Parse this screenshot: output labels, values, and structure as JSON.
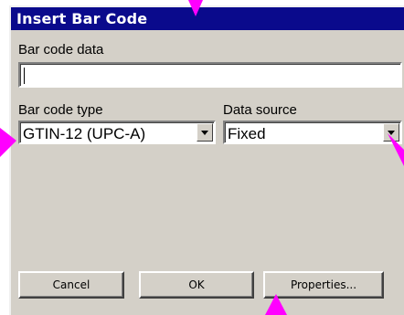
{
  "dialog": {
    "title": "Insert Bar Code"
  },
  "barcode_data": {
    "label": "Bar code data",
    "value": ""
  },
  "barcode_type": {
    "label": "Bar code type",
    "selected": "GTIN-12 (UPC-A)"
  },
  "data_source": {
    "label": "Data source",
    "selected": "Fixed"
  },
  "buttons": {
    "cancel": "Cancel",
    "ok": "OK",
    "properties": "Properties..."
  },
  "icons": {
    "dropdown": "chevron-down-icon",
    "callout": "callout-pointer-icon"
  },
  "colors": {
    "titlebar": "#0a0a8c",
    "dialog_bg": "#d4d0c8",
    "callout": "#ff00ff"
  }
}
